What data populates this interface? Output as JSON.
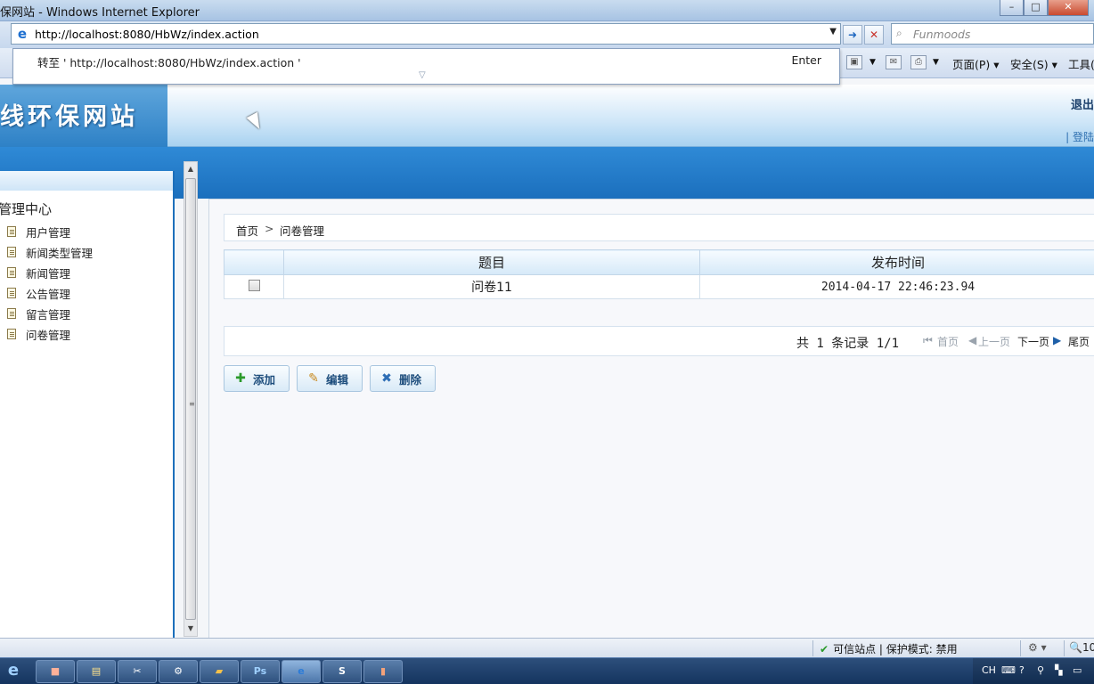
{
  "browser": {
    "window_title": "保网站 - Windows Internet Explorer",
    "address_url": "http://localhost:8080/HbWz/index.action",
    "autocomplete_text": "转至 ' http://localhost:8080/HbWz/index.action '",
    "autocomplete_key": "Enter",
    "search_placeholder": "Funmoods",
    "toolbar": {
      "page_label": "页面(P) ▾",
      "safety_label": "安全(S) ▾",
      "tools_label": "工具("
    },
    "status": {
      "trusted_text": "可信站点 | 保护模式: 禁用",
      "zoom_text": "10"
    }
  },
  "site": {
    "logo_text": "线环保网站",
    "logout_label": "退出",
    "login_info": "| 登陆"
  },
  "sidebar": {
    "title": "管理中心",
    "items": [
      {
        "label": "用户管理"
      },
      {
        "label": "新闻类型管理"
      },
      {
        "label": "新闻管理"
      },
      {
        "label": "公告管理"
      },
      {
        "label": "留言管理"
      },
      {
        "label": "问卷管理"
      }
    ]
  },
  "main": {
    "breadcrumb": {
      "home": "首页",
      "separator": ">",
      "current": "问卷管理"
    },
    "table": {
      "columns": [
        "",
        "题目",
        "发布时间"
      ],
      "rows": [
        {
          "checked": false,
          "title": "问卷11",
          "published": "2014-04-17 22:46:23.94"
        }
      ]
    },
    "pager": {
      "summary": "共 1 条记录 1/1",
      "first": "首页",
      "prev": "上一页",
      "next": "下一页",
      "last": "尾页"
    },
    "actions": {
      "add": "添加",
      "edit": "编辑",
      "delete": "删除"
    }
  },
  "taskbar": {
    "tray_lang": "CH"
  }
}
